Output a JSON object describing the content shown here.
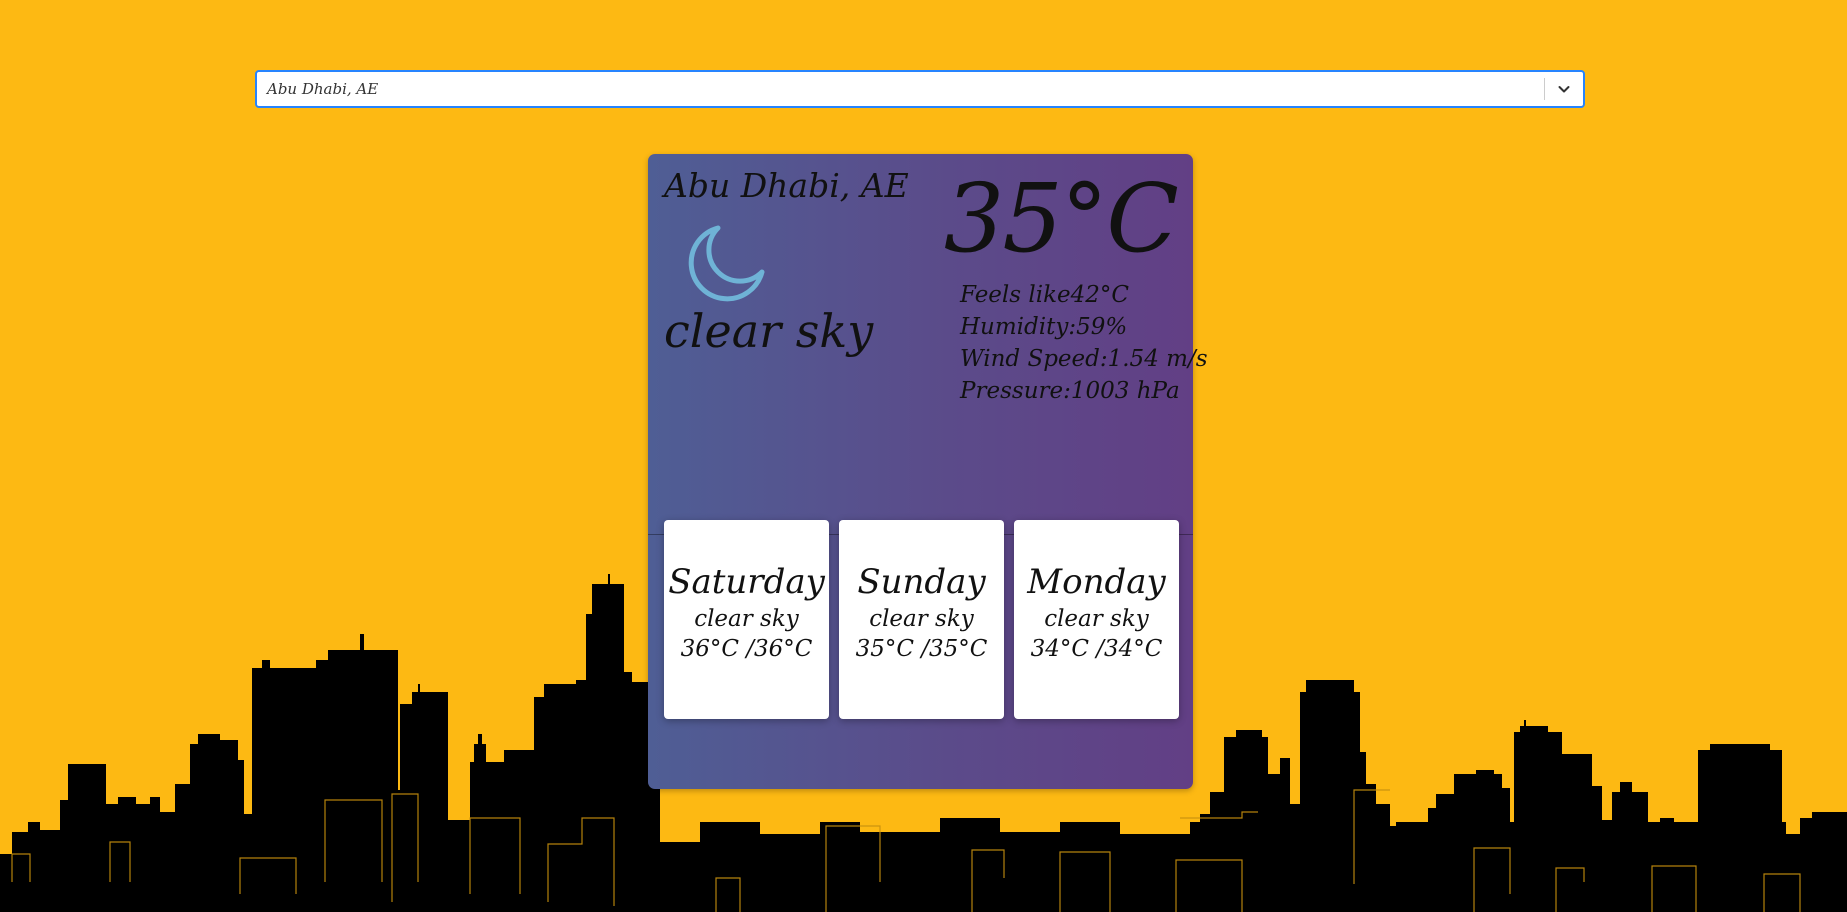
{
  "search": {
    "value": "Abu Dhabi, AE",
    "toggle_icon": "chevron-down-icon"
  },
  "current": {
    "city": "Abu Dhabi, AE",
    "icon": "moon-icon",
    "description": "clear sky",
    "temperature": "35°C",
    "feels_like": "Feels like42°C",
    "humidity": "Humidity:59%",
    "wind_speed": "Wind Speed:1.54 m/s",
    "pressure": "Pressure:1003 hPa"
  },
  "forecast": [
    {
      "day": "Saturday",
      "description": "clear sky",
      "range": "36°C /36°C"
    },
    {
      "day": "Sunday",
      "description": "clear sky",
      "range": "35°C /35°C"
    },
    {
      "day": "Monday",
      "description": "clear sky",
      "range": "34°C /34°C"
    }
  ],
  "colors": {
    "background": "#FDB913",
    "skyline": "#000000",
    "skyline_outline": "#C8900E",
    "icon_color": "#6FB3D6",
    "focus_border": "#2684FF"
  }
}
